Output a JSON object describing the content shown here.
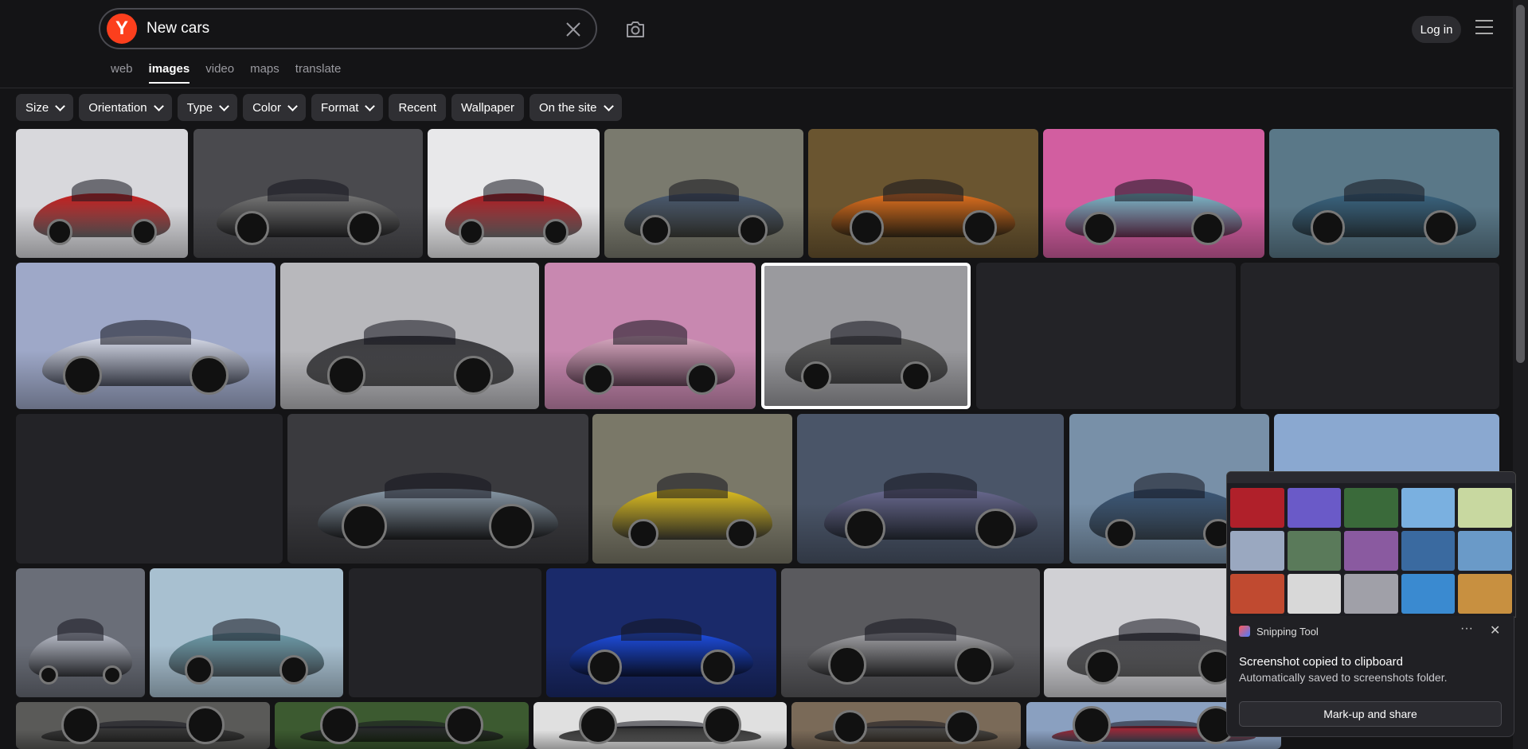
{
  "search": {
    "query": "New cars",
    "logo_letter": "Y"
  },
  "header": {
    "login_label": "Log in"
  },
  "tabs": [
    {
      "label": "web",
      "active": false
    },
    {
      "label": "images",
      "active": true
    },
    {
      "label": "video",
      "active": false
    },
    {
      "label": "maps",
      "active": false
    },
    {
      "label": "translate",
      "active": false
    }
  ],
  "filters": [
    {
      "label": "Size",
      "has_dropdown": true
    },
    {
      "label": "Orientation",
      "has_dropdown": true
    },
    {
      "label": "Type",
      "has_dropdown": true
    },
    {
      "label": "Color",
      "has_dropdown": true
    },
    {
      "label": "Format",
      "has_dropdown": true
    },
    {
      "label": "Recent",
      "has_dropdown": false
    },
    {
      "label": "Wallpaper",
      "has_dropdown": false
    },
    {
      "label": "On the site",
      "has_dropdown": true
    }
  ],
  "images": [
    {
      "name": "red-acura-nsx",
      "bg": "#d8d8dc",
      "car": "#c81e1e",
      "loaded": true
    },
    {
      "name": "grey-ford-gt",
      "bg": "#4a4a4e",
      "car": "#777",
      "loaded": true
    },
    {
      "name": "red-acura-concept",
      "bg": "#e8e8ea",
      "car": "#b01a20",
      "loaded": true
    },
    {
      "name": "car-fleet-aerial",
      "bg": "#7a7a6e",
      "car": "#4a5a70",
      "loaded": true
    },
    {
      "name": "orange-car-dealership",
      "bg": "#6a5530",
      "car": "#e0701e",
      "loaded": true
    },
    {
      "name": "teal-concept-pink",
      "bg": "#d25ea0",
      "car": "#7ab8c8",
      "loaded": true
    },
    {
      "name": "blue-bugatti-tourbillon",
      "bg": "#5a7888",
      "car": "#3a6480",
      "loaded": true
    },
    {
      "name": "silver-concept-sedan",
      "bg": "#9ea8c8",
      "car": "#d8dcea",
      "loaded": true
    },
    {
      "name": "dark-acura-nsx",
      "bg": "#b8b8bc",
      "car": "#3c3c40",
      "loaded": true
    },
    {
      "name": "pink-concept-pair",
      "bg": "#c888b0",
      "car": "#d8a8c0",
      "loaded": true
    },
    {
      "name": "grey-maserati-alfieri",
      "bg": "#9a9a9e",
      "car": "#555",
      "loaded": true
    },
    {
      "name": "placeholder-1",
      "bg": "#232327",
      "car": "",
      "loaded": false
    },
    {
      "name": "placeholder-2",
      "bg": "#232327",
      "car": "",
      "loaded": false
    },
    {
      "name": "placeholder-3",
      "bg": "#232327",
      "car": "",
      "loaded": false
    },
    {
      "name": "silver-bugatti-garage",
      "bg": "#3a3a3e",
      "car": "#8a9aa8",
      "loaded": true
    },
    {
      "name": "yellow-sedan-desert",
      "bg": "#7a7868",
      "car": "#e0c020",
      "loaded": true
    },
    {
      "name": "purple-hypercar-road",
      "bg": "#4a5568",
      "car": "#6a6a90",
      "loaded": true
    },
    {
      "name": "blue-lamborghini",
      "bg": "#7890a8",
      "car": "#3c5878",
      "loaded": true
    },
    {
      "name": "blue-sky-car",
      "bg": "#8aa8d0",
      "car": "#2a3c58",
      "loaded": true
    },
    {
      "name": "silver-concept-city",
      "bg": "#6a6e78",
      "car": "#b8bcc8",
      "loaded": true
    },
    {
      "name": "teal-opel-concept",
      "bg": "#a8c0d0",
      "car": "#6c9aa8",
      "loaded": true
    },
    {
      "name": "placeholder-4",
      "bg": "#232327",
      "car": "",
      "loaded": false
    },
    {
      "name": "blue-cadillac-celestiq",
      "bg": "#1a2a6a",
      "car": "#1e4ee0",
      "loaded": true
    },
    {
      "name": "silver-lexus-concept",
      "bg": "#5a5a5e",
      "car": "#a0a0a4",
      "loaded": true
    },
    {
      "name": "grey-ferrari-296",
      "bg": "#d0d0d4",
      "car": "#4a4a4e",
      "loaded": true
    },
    {
      "name": "row5-image-1",
      "bg": "#5a5a58",
      "car": "#3a3a3a",
      "loaded": true
    },
    {
      "name": "row5-image-2",
      "bg": "#3c5a30",
      "car": "#2a2a2e",
      "loaded": true
    },
    {
      "name": "row5-image-3",
      "bg": "#e0e0e0",
      "car": "#2a2a2a",
      "loaded": true
    },
    {
      "name": "row5-image-4",
      "bg": "#7a6a58",
      "car": "#4a4a4a",
      "loaded": true
    },
    {
      "name": "row5-image-5",
      "bg": "#8aa0c0",
      "car": "#b02030",
      "loaded": true
    }
  ],
  "snip_preview": {
    "thumbs": [
      "#b0202a",
      "#6a5ac8",
      "#3a6a3a",
      "#7ab0e0",
      "#c8d8a0",
      "#9aa8c0",
      "#5a7a5a",
      "#8a5aa0",
      "#3a6aa0",
      "#6a9ac8",
      "#c04a30",
      "#d8d8d8",
      "#a0a0a8",
      "#3a8ad0",
      "#c89040"
    ]
  },
  "toast": {
    "app_name": "Snipping Tool",
    "more_label": "···",
    "close_label": "✕",
    "title": "Screenshot copied to clipboard",
    "message": "Automatically saved to screenshots folder.",
    "action_label": "Mark-up and share"
  }
}
